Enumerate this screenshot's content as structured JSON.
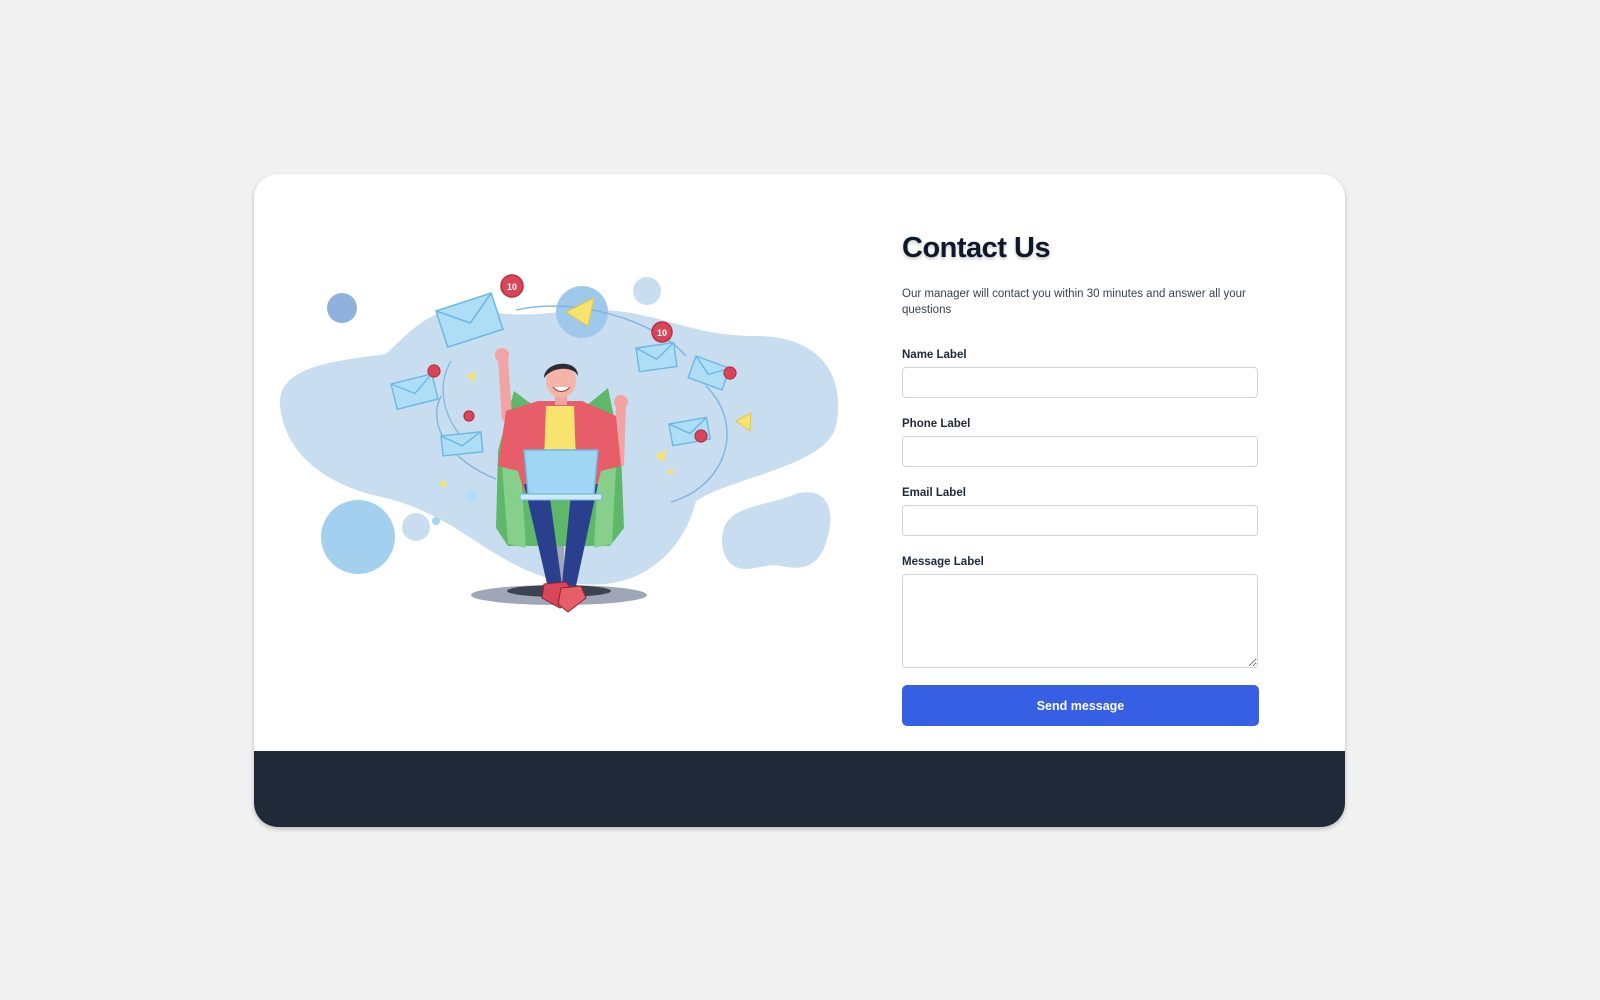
{
  "contact": {
    "title": "Contact Us",
    "subtitle": "Our manager will contact you within 30 minutes and answer all your questions",
    "fields": {
      "name": {
        "label": "Name Label",
        "value": ""
      },
      "phone": {
        "label": "Phone Label",
        "value": ""
      },
      "email": {
        "label": "Email Label",
        "value": ""
      },
      "message": {
        "label": "Message Label",
        "value": ""
      }
    },
    "submit_label": "Send message"
  },
  "illustration": {
    "badges": [
      "10",
      "10"
    ],
    "colors": {
      "blob": "#c8def0",
      "chair": "#5fb769",
      "shirt": "#e85d6a",
      "tshirt": "#f7e36d",
      "jeans": "#2b3f8f",
      "laptop": "#9fd6f3",
      "envelope": "#aeddf6",
      "badge": "#d9465a"
    }
  },
  "theme": {
    "accent": "#365fe3",
    "footer": "#1f2937",
    "page_bg": "#f1f1f1"
  }
}
